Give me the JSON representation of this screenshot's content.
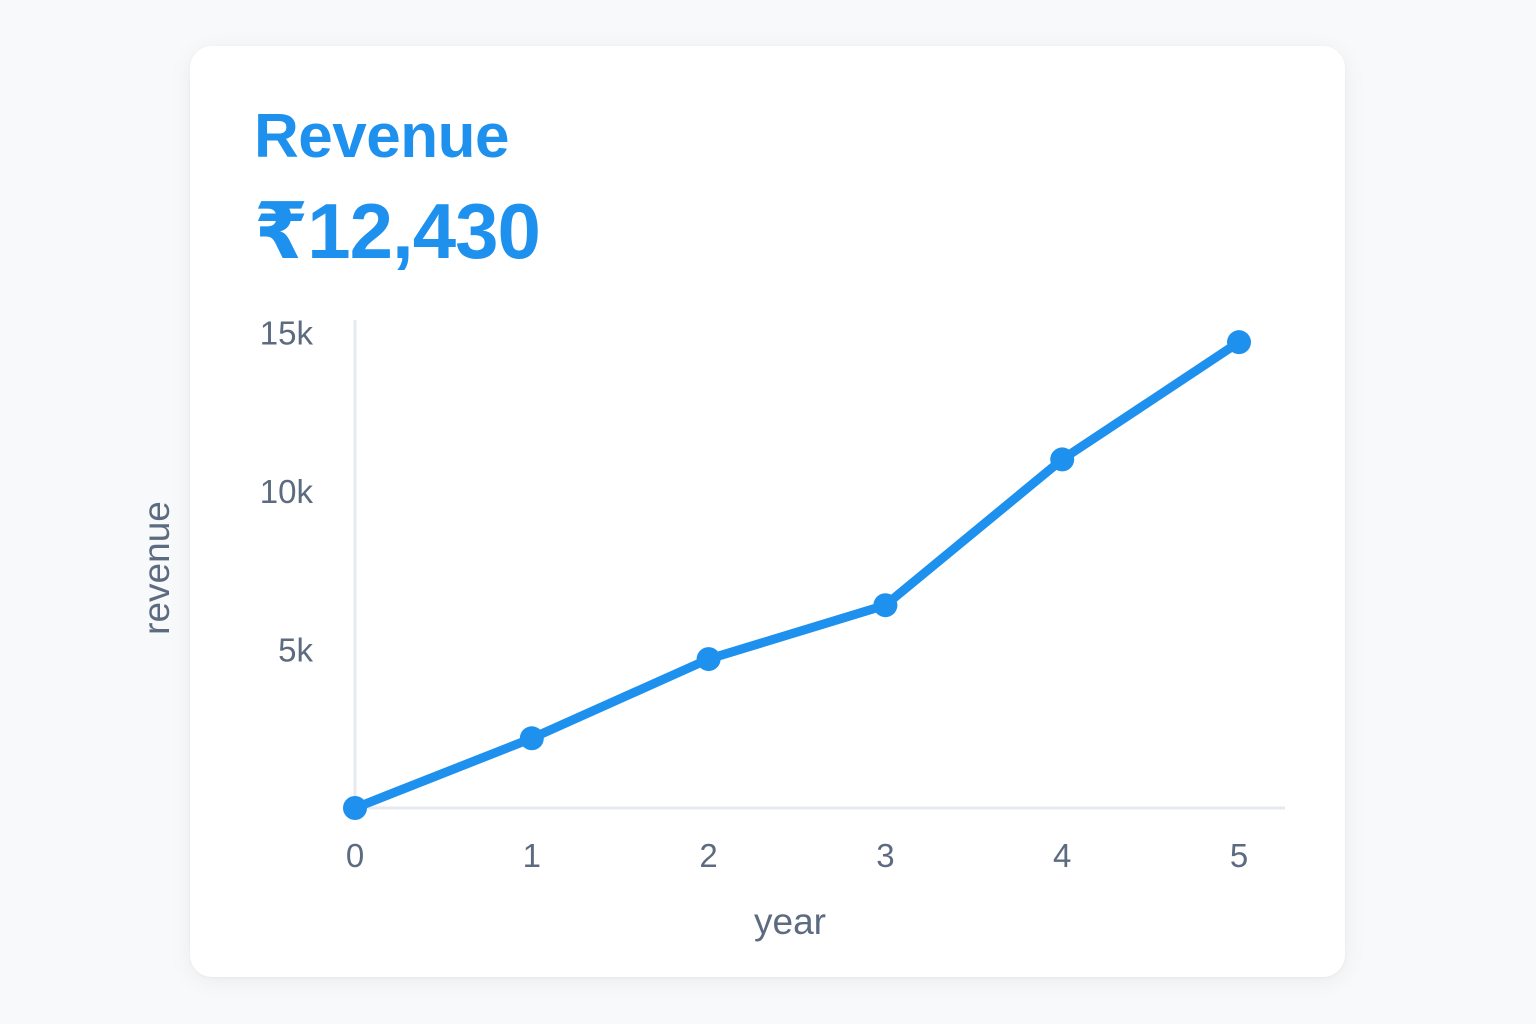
{
  "card": {
    "title": "Revenue",
    "value": "₹12,430"
  },
  "colors": {
    "accent": "#1e90ee",
    "axis": "#e6e9ef",
    "label": "#5c6b80",
    "background": "#f8f9fa",
    "card": "#ffffff"
  },
  "chart_data": {
    "type": "line",
    "xlabel": "year",
    "ylabel": "revenue",
    "x": [
      0,
      1,
      2,
      3,
      4,
      5
    ],
    "x_tick_labels": [
      "0",
      "1",
      "2",
      "3",
      "4",
      "5"
    ],
    "y_ticks": [
      5000,
      10000,
      15000
    ],
    "y_tick_labels": [
      "5k",
      "10k",
      "15k"
    ],
    "xlim": [
      0,
      5.25
    ],
    "ylim": [
      0,
      15400
    ],
    "grid": false,
    "legend": "none",
    "series": [
      {
        "values": [
          0,
          2200,
          4700,
          6400,
          11000,
          14700
        ],
        "color": "#1e90ee"
      }
    ]
  }
}
